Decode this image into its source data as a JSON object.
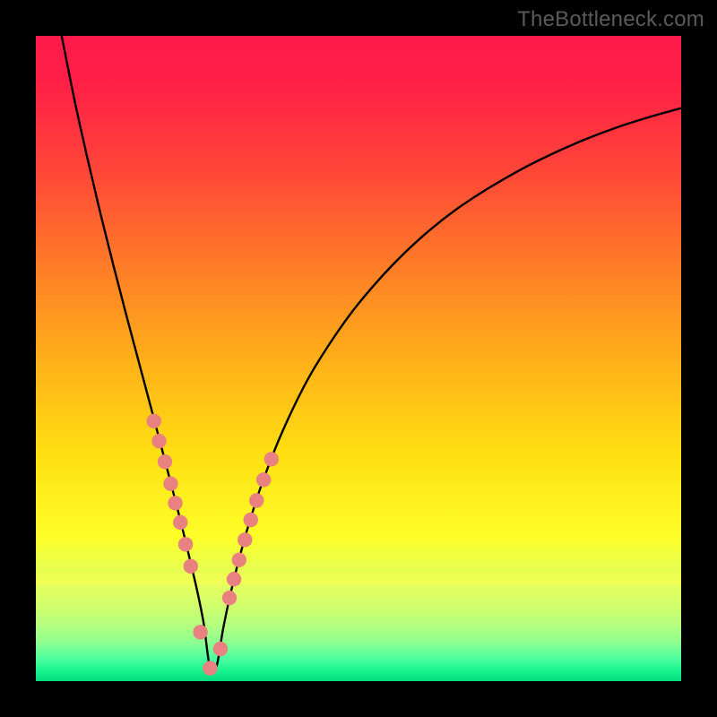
{
  "credit": "TheBottleneck.com",
  "colors": {
    "frame": "#000000",
    "credit": "#5a5a5a",
    "curve": "#000000",
    "marker_fill": "#e8817f",
    "marker_stroke": "#cf6360",
    "gradient_stops": [
      {
        "offset": 0.0,
        "color": "#ff1b4b"
      },
      {
        "offset": 0.07,
        "color": "#ff1f47"
      },
      {
        "offset": 0.2,
        "color": "#ff4339"
      },
      {
        "offset": 0.35,
        "color": "#ff7a28"
      },
      {
        "offset": 0.5,
        "color": "#ffaf1a"
      },
      {
        "offset": 0.65,
        "color": "#ffe012"
      },
      {
        "offset": 0.78,
        "color": "#fdff2a"
      },
      {
        "offset": 0.8,
        "color": "#f2ff3c"
      },
      {
        "offset": 0.835,
        "color": "#e4ff57"
      },
      {
        "offset": 0.845,
        "color": "#e8ff5c"
      },
      {
        "offset": 0.88,
        "color": "#d4ff6a"
      },
      {
        "offset": 0.91,
        "color": "#b8ff7d"
      },
      {
        "offset": 0.94,
        "color": "#8dff90"
      },
      {
        "offset": 0.965,
        "color": "#4dffa0"
      },
      {
        "offset": 0.985,
        "color": "#16f38f"
      },
      {
        "offset": 1.0,
        "color": "#05dd7e"
      }
    ],
    "band_top_color": "#f6ff4e",
    "band_bottom_color": "#f0ff52"
  },
  "chart_data": {
    "type": "line",
    "title": "",
    "xlabel": "",
    "ylabel": "",
    "xlim": [
      0,
      100
    ],
    "ylim": [
      0,
      100
    ],
    "x_vertex": 27,
    "series": [
      {
        "name": "curve",
        "x": [
          4,
          6,
          8,
          10,
          12,
          14,
          16,
          18,
          20,
          21,
          22,
          23,
          24,
          25,
          26,
          27,
          28,
          29,
          30,
          31,
          32,
          33,
          35,
          38,
          42,
          46,
          50,
          55,
          60,
          65,
          70,
          75,
          80,
          85,
          90,
          95,
          100
        ],
        "y": [
          100,
          90,
          81,
          72.5,
          64.5,
          56.8,
          49.3,
          41.8,
          34.2,
          30.4,
          26.5,
          22.5,
          18.3,
          14.0,
          9.0,
          2.0,
          2.3,
          8.0,
          12.8,
          17.0,
          20.8,
          24.3,
          30.5,
          38.2,
          46.5,
          53.0,
          58.5,
          64.2,
          69.0,
          73.0,
          76.3,
          79.2,
          81.7,
          83.9,
          85.8,
          87.4,
          88.8
        ]
      }
    ],
    "markers": {
      "name": "dots",
      "x": [
        18.3,
        19.1,
        20.0,
        20.9,
        21.6,
        22.4,
        23.2,
        24.0,
        25.5,
        27.0,
        28.6,
        30.0,
        30.7,
        31.5,
        32.4,
        33.3,
        34.2,
        35.3,
        36.5
      ],
      "y": [
        40.3,
        37.2,
        34.0,
        30.6,
        27.6,
        24.6,
        21.2,
        17.8,
        7.6,
        2.0,
        5.0,
        12.9,
        15.8,
        18.8,
        21.9,
        25.0,
        28.0,
        31.2,
        34.4
      ]
    }
  }
}
